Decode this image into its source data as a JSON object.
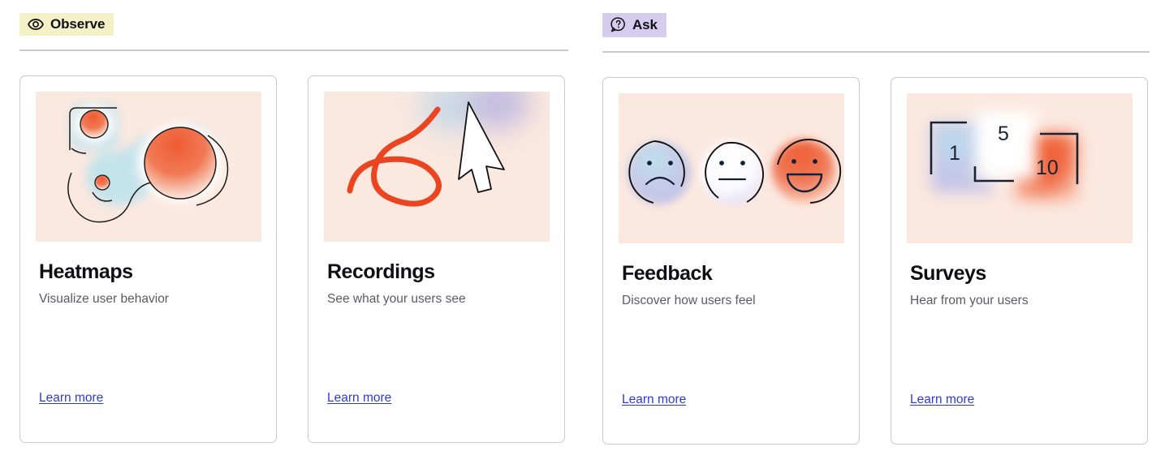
{
  "sections": [
    {
      "id": "observe",
      "badge_label": "Observe",
      "badge_icon": "eye-icon",
      "badge_color": "#f4f1c6",
      "cards": [
        {
          "title": "Heatmaps",
          "subtitle": "Visualize user behavior",
          "link_label": "Learn more",
          "illustration": "heatmap-blob-illustration"
        },
        {
          "title": "Recordings",
          "subtitle": "See what your users see",
          "link_label": "Learn more",
          "illustration": "cursor-trail-illustration"
        }
      ]
    },
    {
      "id": "ask",
      "badge_label": "Ask",
      "badge_icon": "question-bubble-icon",
      "badge_color": "#d6ccee",
      "cards": [
        {
          "title": "Feedback",
          "subtitle": "Discover how users feel",
          "link_label": "Learn more",
          "illustration": "emoji-faces-illustration"
        },
        {
          "title": "Surveys",
          "subtitle": "Hear from your users",
          "link_label": "Learn more",
          "illustration": "rating-scale-illustration",
          "scale_labels": [
            "1",
            "5",
            "10"
          ]
        }
      ]
    }
  ],
  "theme": {
    "link_color": "#2f39d6",
    "illustration_bg": "#fbe8df",
    "accent_red": "#e8472a",
    "accent_blue": "#bfe3ec",
    "card_border": "#c9c9d4",
    "divider": "#c9c9cf"
  }
}
